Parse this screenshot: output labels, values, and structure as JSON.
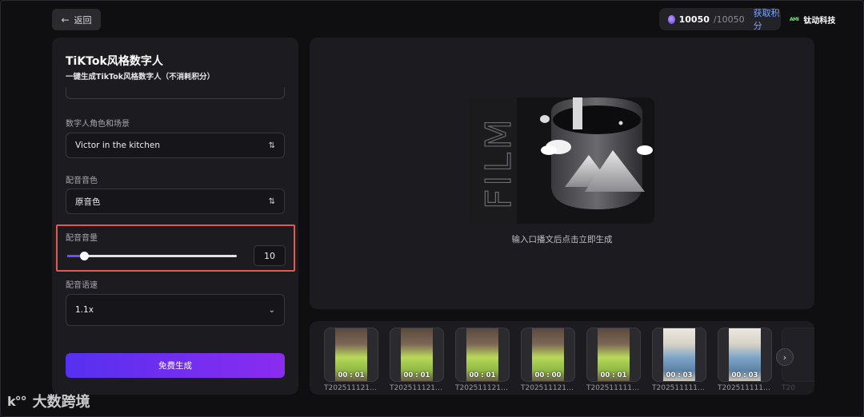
{
  "header": {
    "back_label": "返回",
    "credits_current": "10050",
    "credits_total": "/10050",
    "get_credits_label": "获取积分",
    "brand_logo_text": "AMI",
    "brand_name": "钛动科技"
  },
  "left_panel": {
    "title": "TiKTok风格数字人",
    "subtitle": "一键生成TikTok风格数字人（不消耗积分）",
    "role_label": "数字人角色和场景",
    "role_value": "Victor in the kitchen",
    "voice_label": "配音音色",
    "voice_value": "原音色",
    "volume_label": "配音音量",
    "volume_value": "10",
    "volume_fraction": 0.1,
    "speed_label": "配音语速",
    "speed_value": "1.1x",
    "generate_label": "免费生成"
  },
  "preview": {
    "film_text": "FILM",
    "hint": "输入口播文后点击立即生成"
  },
  "thumbnails": [
    {
      "duration": "00 : 01",
      "name": "T202511121…",
      "style": "green"
    },
    {
      "duration": "00 : 01",
      "name": "T202511121…",
      "style": "green"
    },
    {
      "duration": "00 : 01",
      "name": "T202511121…",
      "style": "green"
    },
    {
      "duration": "00 : 00",
      "name": "T202511121…",
      "style": "green"
    },
    {
      "duration": "00 : 01",
      "name": "T202511111…",
      "style": "green"
    },
    {
      "duration": "00 : 03",
      "name": "T202511111…",
      "style": "blue"
    },
    {
      "duration": "00 : 03",
      "name": "T202511111…",
      "style": "blue"
    }
  ],
  "partial_thumb_name": "T20",
  "watermark": {
    "mark": "k°°",
    "text": "大数跨境"
  },
  "colors": {
    "accent_start": "#5630f0",
    "accent_end": "#8a2cf0",
    "highlight_border": "#e05a52",
    "link": "#7aa7ff"
  }
}
